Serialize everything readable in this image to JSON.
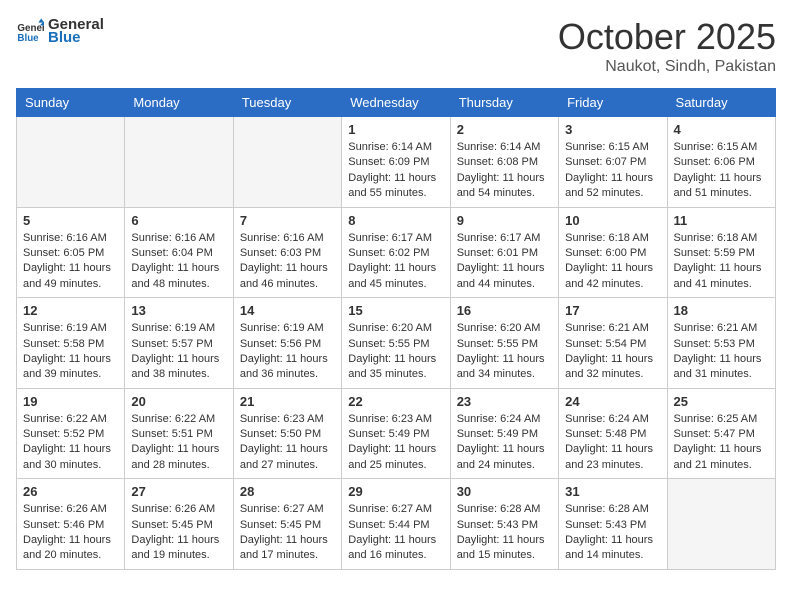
{
  "header": {
    "logo_general": "General",
    "logo_blue": "Blue",
    "month": "October 2025",
    "location": "Naukot, Sindh, Pakistan"
  },
  "days_of_week": [
    "Sunday",
    "Monday",
    "Tuesday",
    "Wednesday",
    "Thursday",
    "Friday",
    "Saturday"
  ],
  "weeks": [
    [
      {
        "day": "",
        "info": ""
      },
      {
        "day": "",
        "info": ""
      },
      {
        "day": "",
        "info": ""
      },
      {
        "day": "1",
        "sunrise": "Sunrise: 6:14 AM",
        "sunset": "Sunset: 6:09 PM",
        "daylight": "Daylight: 11 hours and 55 minutes."
      },
      {
        "day": "2",
        "sunrise": "Sunrise: 6:14 AM",
        "sunset": "Sunset: 6:08 PM",
        "daylight": "Daylight: 11 hours and 54 minutes."
      },
      {
        "day": "3",
        "sunrise": "Sunrise: 6:15 AM",
        "sunset": "Sunset: 6:07 PM",
        "daylight": "Daylight: 11 hours and 52 minutes."
      },
      {
        "day": "4",
        "sunrise": "Sunrise: 6:15 AM",
        "sunset": "Sunset: 6:06 PM",
        "daylight": "Daylight: 11 hours and 51 minutes."
      }
    ],
    [
      {
        "day": "5",
        "sunrise": "Sunrise: 6:16 AM",
        "sunset": "Sunset: 6:05 PM",
        "daylight": "Daylight: 11 hours and 49 minutes."
      },
      {
        "day": "6",
        "sunrise": "Sunrise: 6:16 AM",
        "sunset": "Sunset: 6:04 PM",
        "daylight": "Daylight: 11 hours and 48 minutes."
      },
      {
        "day": "7",
        "sunrise": "Sunrise: 6:16 AM",
        "sunset": "Sunset: 6:03 PM",
        "daylight": "Daylight: 11 hours and 46 minutes."
      },
      {
        "day": "8",
        "sunrise": "Sunrise: 6:17 AM",
        "sunset": "Sunset: 6:02 PM",
        "daylight": "Daylight: 11 hours and 45 minutes."
      },
      {
        "day": "9",
        "sunrise": "Sunrise: 6:17 AM",
        "sunset": "Sunset: 6:01 PM",
        "daylight": "Daylight: 11 hours and 44 minutes."
      },
      {
        "day": "10",
        "sunrise": "Sunrise: 6:18 AM",
        "sunset": "Sunset: 6:00 PM",
        "daylight": "Daylight: 11 hours and 42 minutes."
      },
      {
        "day": "11",
        "sunrise": "Sunrise: 6:18 AM",
        "sunset": "Sunset: 5:59 PM",
        "daylight": "Daylight: 11 hours and 41 minutes."
      }
    ],
    [
      {
        "day": "12",
        "sunrise": "Sunrise: 6:19 AM",
        "sunset": "Sunset: 5:58 PM",
        "daylight": "Daylight: 11 hours and 39 minutes."
      },
      {
        "day": "13",
        "sunrise": "Sunrise: 6:19 AM",
        "sunset": "Sunset: 5:57 PM",
        "daylight": "Daylight: 11 hours and 38 minutes."
      },
      {
        "day": "14",
        "sunrise": "Sunrise: 6:19 AM",
        "sunset": "Sunset: 5:56 PM",
        "daylight": "Daylight: 11 hours and 36 minutes."
      },
      {
        "day": "15",
        "sunrise": "Sunrise: 6:20 AM",
        "sunset": "Sunset: 5:55 PM",
        "daylight": "Daylight: 11 hours and 35 minutes."
      },
      {
        "day": "16",
        "sunrise": "Sunrise: 6:20 AM",
        "sunset": "Sunset: 5:55 PM",
        "daylight": "Daylight: 11 hours and 34 minutes."
      },
      {
        "day": "17",
        "sunrise": "Sunrise: 6:21 AM",
        "sunset": "Sunset: 5:54 PM",
        "daylight": "Daylight: 11 hours and 32 minutes."
      },
      {
        "day": "18",
        "sunrise": "Sunrise: 6:21 AM",
        "sunset": "Sunset: 5:53 PM",
        "daylight": "Daylight: 11 hours and 31 minutes."
      }
    ],
    [
      {
        "day": "19",
        "sunrise": "Sunrise: 6:22 AM",
        "sunset": "Sunset: 5:52 PM",
        "daylight": "Daylight: 11 hours and 30 minutes."
      },
      {
        "day": "20",
        "sunrise": "Sunrise: 6:22 AM",
        "sunset": "Sunset: 5:51 PM",
        "daylight": "Daylight: 11 hours and 28 minutes."
      },
      {
        "day": "21",
        "sunrise": "Sunrise: 6:23 AM",
        "sunset": "Sunset: 5:50 PM",
        "daylight": "Daylight: 11 hours and 27 minutes."
      },
      {
        "day": "22",
        "sunrise": "Sunrise: 6:23 AM",
        "sunset": "Sunset: 5:49 PM",
        "daylight": "Daylight: 11 hours and 25 minutes."
      },
      {
        "day": "23",
        "sunrise": "Sunrise: 6:24 AM",
        "sunset": "Sunset: 5:49 PM",
        "daylight": "Daylight: 11 hours and 24 minutes."
      },
      {
        "day": "24",
        "sunrise": "Sunrise: 6:24 AM",
        "sunset": "Sunset: 5:48 PM",
        "daylight": "Daylight: 11 hours and 23 minutes."
      },
      {
        "day": "25",
        "sunrise": "Sunrise: 6:25 AM",
        "sunset": "Sunset: 5:47 PM",
        "daylight": "Daylight: 11 hours and 21 minutes."
      }
    ],
    [
      {
        "day": "26",
        "sunrise": "Sunrise: 6:26 AM",
        "sunset": "Sunset: 5:46 PM",
        "daylight": "Daylight: 11 hours and 20 minutes."
      },
      {
        "day": "27",
        "sunrise": "Sunrise: 6:26 AM",
        "sunset": "Sunset: 5:45 PM",
        "daylight": "Daylight: 11 hours and 19 minutes."
      },
      {
        "day": "28",
        "sunrise": "Sunrise: 6:27 AM",
        "sunset": "Sunset: 5:45 PM",
        "daylight": "Daylight: 11 hours and 17 minutes."
      },
      {
        "day": "29",
        "sunrise": "Sunrise: 6:27 AM",
        "sunset": "Sunset: 5:44 PM",
        "daylight": "Daylight: 11 hours and 16 minutes."
      },
      {
        "day": "30",
        "sunrise": "Sunrise: 6:28 AM",
        "sunset": "Sunset: 5:43 PM",
        "daylight": "Daylight: 11 hours and 15 minutes."
      },
      {
        "day": "31",
        "sunrise": "Sunrise: 6:28 AM",
        "sunset": "Sunset: 5:43 PM",
        "daylight": "Daylight: 11 hours and 14 minutes."
      },
      {
        "day": "",
        "info": ""
      }
    ]
  ]
}
